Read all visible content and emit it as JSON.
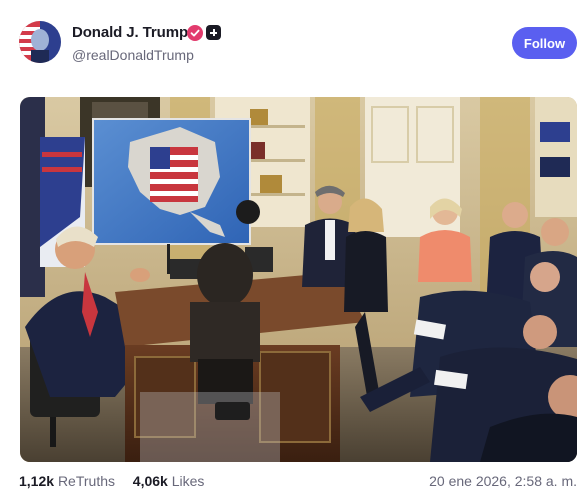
{
  "author": {
    "display_name": "Donald J. Trump",
    "username": "@realDonaldTrump"
  },
  "follow_label": "Follow",
  "media": {
    "kind": "photo",
    "icons": [
      "verified-icon",
      "plus-badge-icon"
    ]
  },
  "stats": {
    "retruths_count": "1,12k",
    "retruths_label": "ReTruths",
    "likes_count": "4,06k",
    "likes_label": "Likes"
  },
  "timestamp": "20 ene 2026, 2:58 a. m.",
  "colors": {
    "accent": "#5a5ff0",
    "verified": "#e23b6d",
    "text_primary": "#1b1b25",
    "text_secondary": "#68687a"
  }
}
